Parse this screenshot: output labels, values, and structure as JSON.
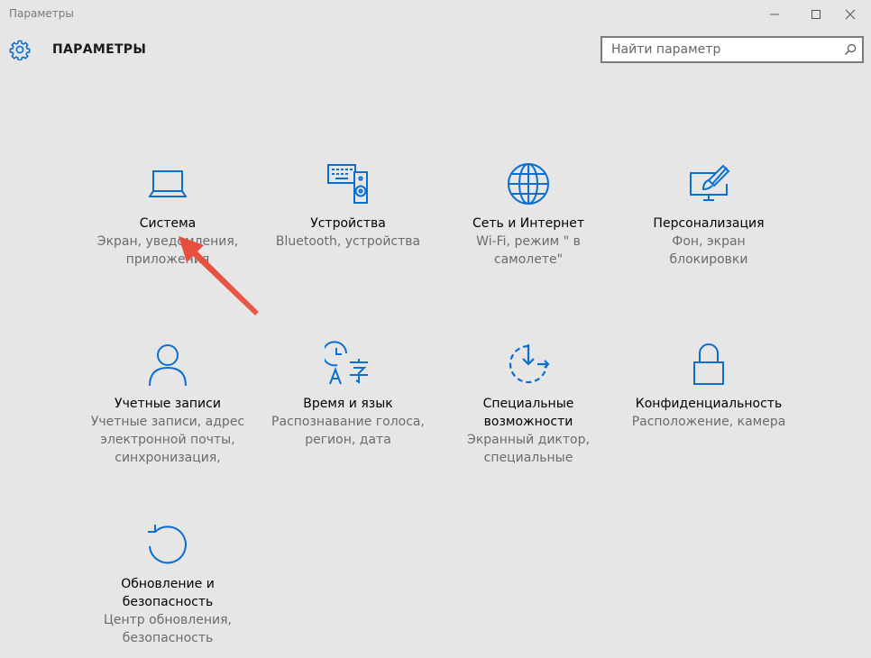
{
  "window": {
    "title": "Параметры"
  },
  "header": {
    "title": "ПАРАМЕТРЫ",
    "search_placeholder": "Найти параметр"
  },
  "colors": {
    "accent": "#0a6fd0",
    "background": "#e6e6e6",
    "annotation_arrow": "#e74c3c"
  },
  "tiles": [
    {
      "name": "Система",
      "desc_lines": [
        "Экран, уведомления,",
        "приложения"
      ],
      "icon": "laptop-icon"
    },
    {
      "name": "Устройства",
      "desc_lines": [
        "Bluetooth, устройства"
      ],
      "icon": "keyboard-speaker-icon"
    },
    {
      "name": "Сеть и Интернет",
      "desc_lines": [
        "Wi-Fi, режим \" в",
        "самолете\""
      ],
      "icon": "globe-icon"
    },
    {
      "name": "Персонализация",
      "desc_lines": [
        "Фон, экран",
        "блокировки"
      ],
      "icon": "paint-screen-icon"
    },
    {
      "name": "Учетные записи",
      "desc_lines": [
        "Учетные записи, адрес",
        "электронной почты,",
        "синхронизация,"
      ],
      "icon": "person-icon"
    },
    {
      "name": "Время и язык",
      "desc_lines": [
        "Распознавание голоса,",
        "регион, дата"
      ],
      "icon": "clock-language-icon"
    },
    {
      "name_lines": [
        "Специальные",
        "возможности"
      ],
      "desc_lines": [
        "Экранный диктор,",
        "специальные"
      ],
      "icon": "ease-of-access-icon"
    },
    {
      "name": "Конфиденциальность",
      "desc_lines": [
        "Расположение, камера"
      ],
      "icon": "lock-icon"
    },
    {
      "name_lines": [
        "Обновление и",
        "безопасность"
      ],
      "desc_lines": [
        "Центр обновления,",
        "безопасность"
      ],
      "icon": "refresh-icon"
    }
  ]
}
